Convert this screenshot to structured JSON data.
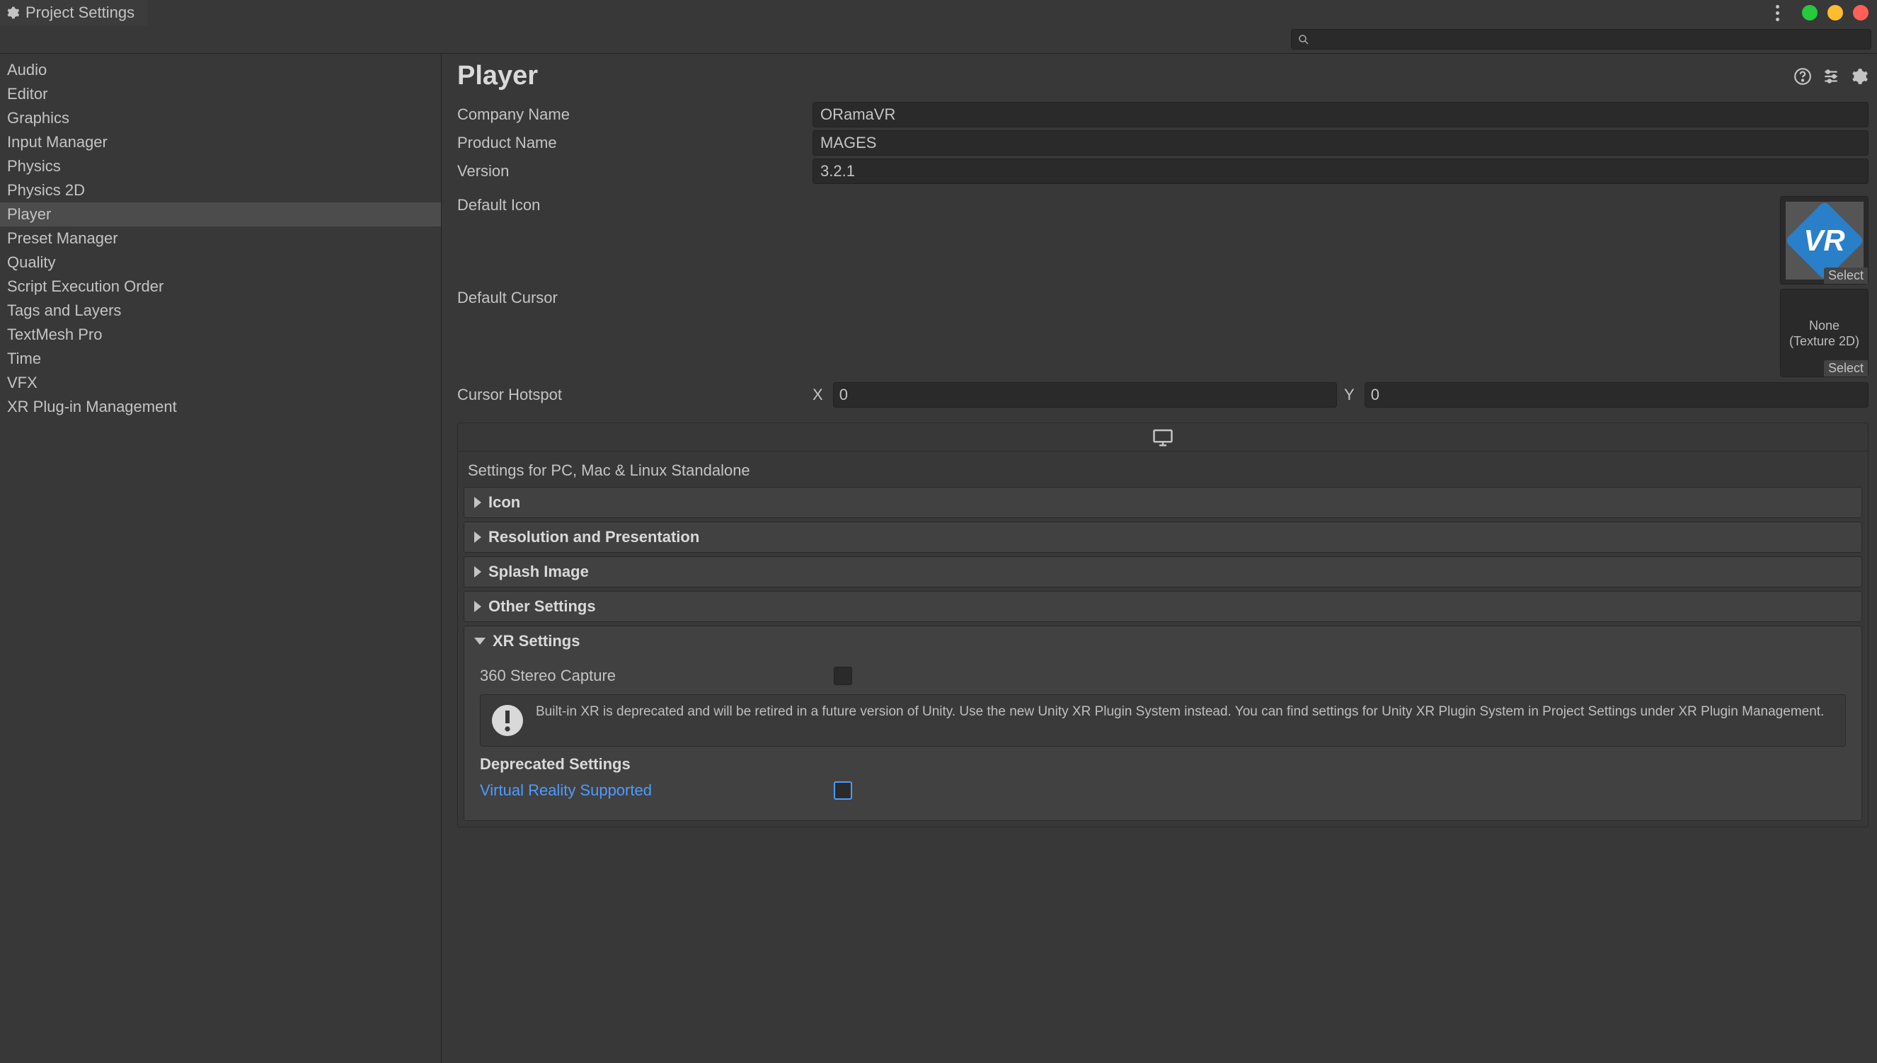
{
  "window": {
    "title": "Project Settings"
  },
  "sidebar": {
    "items": [
      {
        "label": "Audio",
        "selected": false
      },
      {
        "label": "Editor",
        "selected": false
      },
      {
        "label": "Graphics",
        "selected": false
      },
      {
        "label": "Input Manager",
        "selected": false
      },
      {
        "label": "Physics",
        "selected": false
      },
      {
        "label": "Physics 2D",
        "selected": false
      },
      {
        "label": "Player",
        "selected": true
      },
      {
        "label": "Preset Manager",
        "selected": false
      },
      {
        "label": "Quality",
        "selected": false
      },
      {
        "label": "Script Execution Order",
        "selected": false
      },
      {
        "label": "Tags and Layers",
        "selected": false
      },
      {
        "label": "TextMesh Pro",
        "selected": false
      },
      {
        "label": "Time",
        "selected": false
      },
      {
        "label": "VFX",
        "selected": false
      },
      {
        "label": "XR Plug-in Management",
        "selected": false
      }
    ]
  },
  "header": {
    "title": "Player"
  },
  "fields": {
    "company_name": {
      "label": "Company Name",
      "value": "ORamaVR"
    },
    "product_name": {
      "label": "Product Name",
      "value": "MAGES"
    },
    "version": {
      "label": "Version",
      "value": "3.2.1"
    },
    "default_icon": {
      "label": "Default Icon",
      "select": "Select"
    },
    "default_cursor": {
      "label": "Default Cursor",
      "none_line1": "None",
      "none_line2": "(Texture 2D)",
      "select": "Select"
    },
    "cursor_hotspot": {
      "label": "Cursor Hotspot",
      "x_label": "X",
      "x_value": "0",
      "y_label": "Y",
      "y_value": "0"
    }
  },
  "platform": {
    "subtitle": "Settings for PC, Mac & Linux Standalone",
    "foldouts": {
      "icon": {
        "title": "Icon"
      },
      "resolution": {
        "title": "Resolution and Presentation"
      },
      "splash": {
        "title": "Splash Image"
      },
      "other": {
        "title": "Other Settings"
      },
      "xr": {
        "title": "XR Settings",
        "stereo_label": "360 Stereo Capture",
        "warning": "Built-in XR is deprecated and will be retired in a future version of Unity. Use the new Unity XR Plugin System instead. You can find settings for Unity XR Plugin System in Project Settings under XR Plugin Management.",
        "deprecated_title": "Deprecated Settings",
        "vr_supported_label": "Virtual Reality Supported"
      }
    }
  },
  "icons": {
    "gear": "gear-icon",
    "search": "search-icon",
    "help": "help-icon",
    "settings": "settings-icon",
    "more": "more-icon",
    "monitor": "monitor-icon",
    "warning": "warning-icon"
  },
  "vr_logo_text": "VR"
}
